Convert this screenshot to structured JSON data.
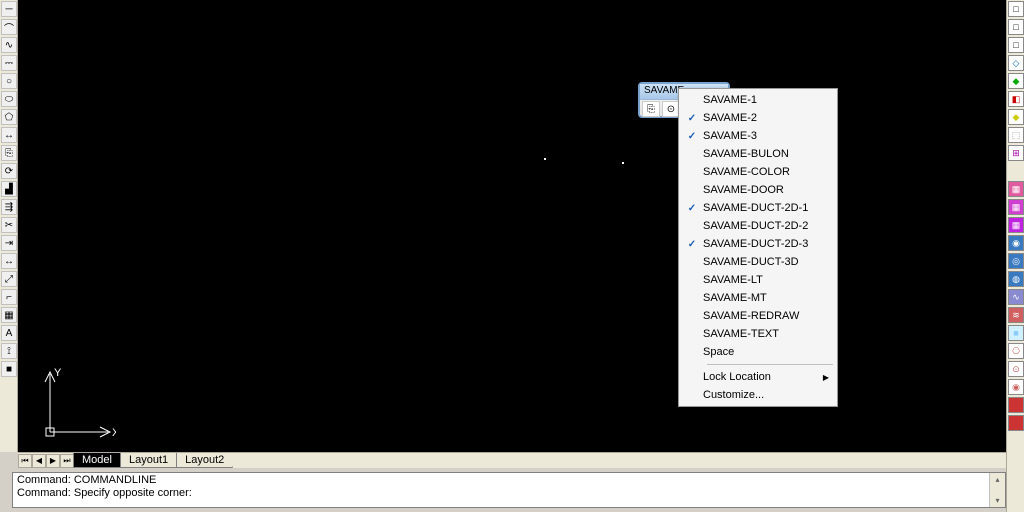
{
  "left_tools": [
    "line",
    "arc",
    "spline",
    "polyline",
    "circle",
    "ellipse",
    "polygon",
    "move",
    "copy",
    "rotate",
    "mirror",
    "offset",
    "trim",
    "extend",
    "stretch",
    "scale",
    "fillet",
    "hatch",
    "text",
    "dim",
    "block"
  ],
  "right_tools": [
    {
      "glyph": "□",
      "color": "#000",
      "bg": "#fff"
    },
    {
      "glyph": "□",
      "color": "#000",
      "bg": "#fff"
    },
    {
      "glyph": "□",
      "color": "#000",
      "bg": "#fff"
    },
    {
      "glyph": "◇",
      "color": "#06c",
      "bg": "#fff"
    },
    {
      "glyph": "◆",
      "color": "#0a0",
      "bg": "#fff"
    },
    {
      "glyph": "◧",
      "color": "#c00",
      "bg": "#fff"
    },
    {
      "glyph": "◆",
      "color": "#cc0",
      "bg": "#fff"
    },
    {
      "glyph": "⬚",
      "color": "#888",
      "bg": "#fff"
    },
    {
      "glyph": "⊞",
      "color": "#a0a",
      "bg": "#fff"
    },
    {
      "glyph": "",
      "color": "#000",
      "bg": "transparent"
    },
    {
      "glyph": "▦",
      "color": "#fff",
      "bg": "#e05aa0"
    },
    {
      "glyph": "▦",
      "color": "#fff",
      "bg": "#d040d0"
    },
    {
      "glyph": "▦",
      "color": "#fff",
      "bg": "#c020e0"
    },
    {
      "glyph": "◉",
      "color": "#fff",
      "bg": "#3a7ac0"
    },
    {
      "glyph": "◎",
      "color": "#fff",
      "bg": "#3a7ac0"
    },
    {
      "glyph": "◍",
      "color": "#fff",
      "bg": "#3a7ac0"
    },
    {
      "glyph": "∿",
      "color": "#fff",
      "bg": "#8a8ad0"
    },
    {
      "glyph": "≋",
      "color": "#fff",
      "bg": "#d06060"
    },
    {
      "glyph": "■",
      "color": "#8cf",
      "bg": "#d0f0ff"
    },
    {
      "glyph": "⎔",
      "color": "#c66",
      "bg": "#fff"
    },
    {
      "glyph": "⊙",
      "color": "#c66",
      "bg": "#fff"
    },
    {
      "glyph": "◉",
      "color": "#c66",
      "bg": "#fff"
    },
    {
      "glyph": "■",
      "color": "#c33",
      "bg": "#c33"
    },
    {
      "glyph": "■",
      "color": "#c33",
      "bg": "#c33"
    }
  ],
  "ucs": {
    "x": "X",
    "y": "Y"
  },
  "tabs_nav": {
    "first": "⏮",
    "prev": "◀",
    "next": "▶",
    "last": "⏭"
  },
  "tabs": [
    {
      "label": "Model",
      "active": true
    },
    {
      "label": "Layout1",
      "active": false
    },
    {
      "label": "Layout2",
      "active": false
    }
  ],
  "command_lines": [
    "Command: COMMANDLINE",
    "Command: Specify opposite corner:"
  ],
  "floating_toolbar": {
    "title": "SAVAME...",
    "btn1": "⎘",
    "btn2": "⊙"
  },
  "context_menu": {
    "items": [
      {
        "label": "SAVAME-1",
        "checked": false
      },
      {
        "label": "SAVAME-2",
        "checked": true
      },
      {
        "label": "SAVAME-3",
        "checked": true
      },
      {
        "label": "SAVAME-BULON",
        "checked": false
      },
      {
        "label": "SAVAME-COLOR",
        "checked": false
      },
      {
        "label": "SAVAME-DOOR",
        "checked": false
      },
      {
        "label": "SAVAME-DUCT-2D-1",
        "checked": true
      },
      {
        "label": "SAVAME-DUCT-2D-2",
        "checked": false
      },
      {
        "label": "SAVAME-DUCT-2D-3",
        "checked": true
      },
      {
        "label": "SAVAME-DUCT-3D",
        "checked": false
      },
      {
        "label": "SAVAME-LT",
        "checked": false
      },
      {
        "label": "SAVAME-MT",
        "checked": false
      },
      {
        "label": "SAVAME-REDRAW",
        "checked": false
      },
      {
        "label": "SAVAME-TEXT",
        "checked": false
      },
      {
        "label": "Space",
        "checked": false
      }
    ],
    "footer": [
      {
        "label": "Lock Location",
        "submenu": true
      },
      {
        "label": "Customize...",
        "submenu": false
      }
    ]
  }
}
